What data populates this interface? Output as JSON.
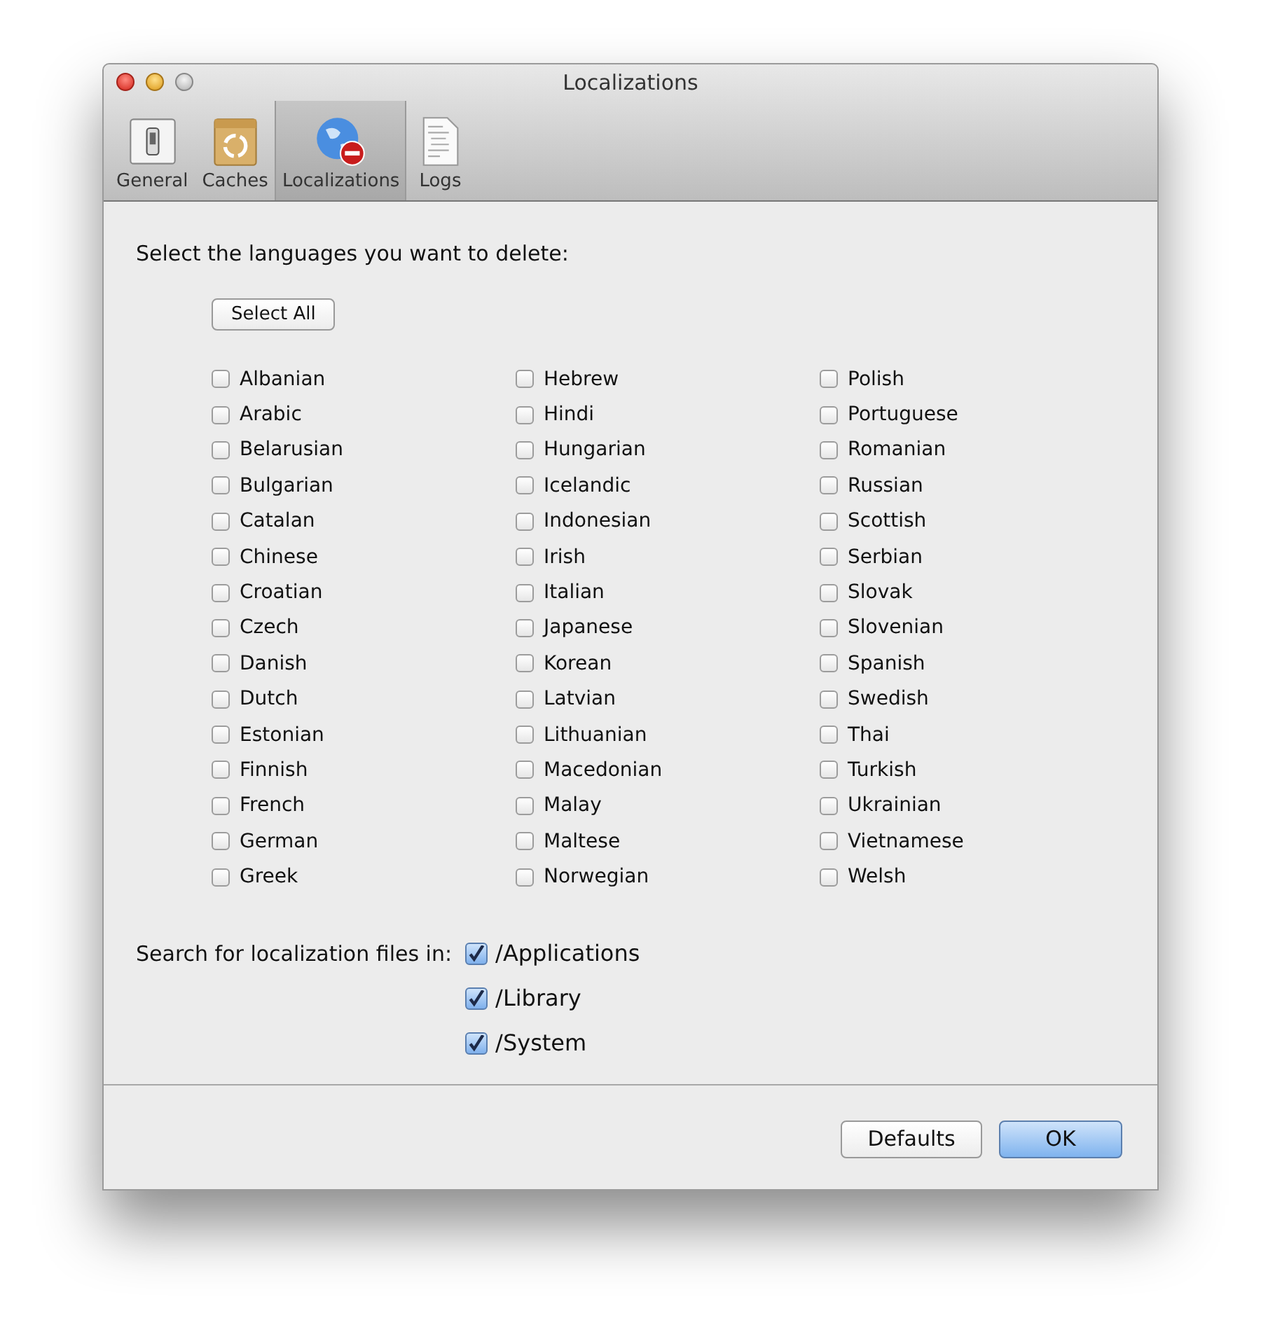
{
  "window": {
    "title": "Localizations"
  },
  "toolbar": [
    {
      "label": "General",
      "kind": "switch",
      "selected": false
    },
    {
      "label": "Caches",
      "kind": "box",
      "selected": false
    },
    {
      "label": "Localizations",
      "kind": "globe",
      "selected": true
    },
    {
      "label": "Logs",
      "kind": "document",
      "selected": false
    }
  ],
  "heading": "Select the languages you want to delete:",
  "select_all_button": "Select All",
  "language_columns": [
    [
      {
        "label": "Albanian",
        "checked": false
      },
      {
        "label": "Arabic",
        "checked": false
      },
      {
        "label": "Belarusian",
        "checked": false
      },
      {
        "label": "Bulgarian",
        "checked": false
      },
      {
        "label": "Catalan",
        "checked": false
      },
      {
        "label": "Chinese",
        "checked": false
      },
      {
        "label": "Croatian",
        "checked": false
      },
      {
        "label": "Czech",
        "checked": false
      },
      {
        "label": "Danish",
        "checked": false
      },
      {
        "label": "Dutch",
        "checked": false
      },
      {
        "label": "Estonian",
        "checked": false
      },
      {
        "label": "Finnish",
        "checked": false
      },
      {
        "label": "French",
        "checked": false
      },
      {
        "label": "German",
        "checked": false
      },
      {
        "label": "Greek",
        "checked": false
      }
    ],
    [
      {
        "label": "Hebrew",
        "checked": false
      },
      {
        "label": "Hindi",
        "checked": false
      },
      {
        "label": "Hungarian",
        "checked": false
      },
      {
        "label": "Icelandic",
        "checked": false
      },
      {
        "label": "Indonesian",
        "checked": false
      },
      {
        "label": "Irish",
        "checked": false
      },
      {
        "label": "Italian",
        "checked": false
      },
      {
        "label": "Japanese",
        "checked": false
      },
      {
        "label": "Korean",
        "checked": false
      },
      {
        "label": "Latvian",
        "checked": false
      },
      {
        "label": "Lithuanian",
        "checked": false
      },
      {
        "label": "Macedonian",
        "checked": false
      },
      {
        "label": "Malay",
        "checked": false
      },
      {
        "label": "Maltese",
        "checked": false
      },
      {
        "label": "Norwegian",
        "checked": false
      }
    ],
    [
      {
        "label": "Polish",
        "checked": false
      },
      {
        "label": "Portuguese",
        "checked": false
      },
      {
        "label": "Romanian",
        "checked": false
      },
      {
        "label": "Russian",
        "checked": false
      },
      {
        "label": "Scottish",
        "checked": false
      },
      {
        "label": "Serbian",
        "checked": false
      },
      {
        "label": "Slovak",
        "checked": false
      },
      {
        "label": "Slovenian",
        "checked": false
      },
      {
        "label": "Spanish",
        "checked": false
      },
      {
        "label": "Swedish",
        "checked": false
      },
      {
        "label": "Thai",
        "checked": false
      },
      {
        "label": "Turkish",
        "checked": false
      },
      {
        "label": "Ukrainian",
        "checked": false
      },
      {
        "label": "Vietnamese",
        "checked": false
      },
      {
        "label": "Welsh",
        "checked": false
      }
    ]
  ],
  "search": {
    "label": "Search for localization files in:",
    "locations": [
      {
        "label": "/Applications",
        "checked": true
      },
      {
        "label": "/Library",
        "checked": true
      },
      {
        "label": "/System",
        "checked": true
      }
    ]
  },
  "buttons": [
    {
      "label": "Defaults",
      "kind": "normal"
    },
    {
      "label": "OK",
      "kind": "default"
    }
  ]
}
